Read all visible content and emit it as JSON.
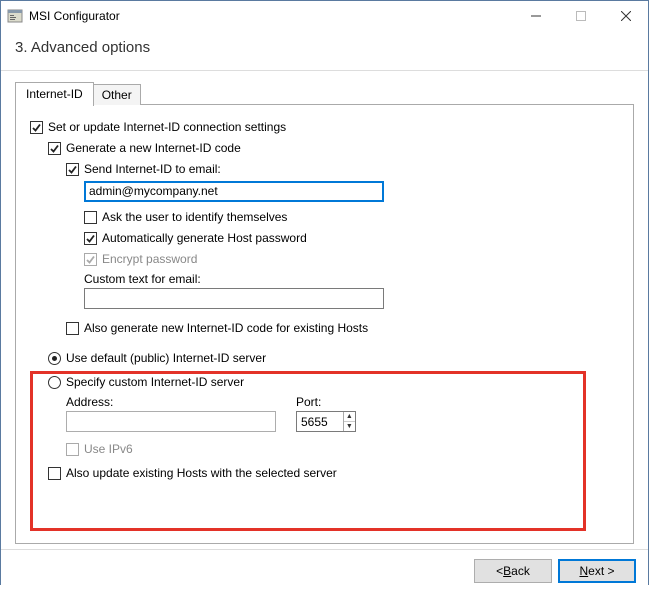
{
  "window": {
    "title": "MSI Configurator",
    "step_title": "3. Advanced options"
  },
  "tabs": {
    "active": "Internet-ID",
    "other": "Other"
  },
  "options": {
    "set_update": "Set or update Internet-ID connection settings",
    "generate_code": "Generate a new Internet-ID code",
    "send_email": "Send Internet-ID to email:",
    "email_value": "admin@mycompany.net",
    "ask_identify": "Ask the user to identify themselves",
    "auto_password": "Automatically generate Host password",
    "encrypt_password": "Encrypt password",
    "custom_text_label": "Custom text for email:",
    "custom_text_value": "",
    "also_generate_existing": "Also generate new Internet-ID code for existing Hosts",
    "use_default_server": "Use default (public) Internet-ID server",
    "specify_custom_server": "Specify custom Internet-ID server",
    "address_label": "Address:",
    "address_value": "",
    "port_label": "Port:",
    "port_value": "5655",
    "use_ipv6": "Use IPv6",
    "also_update_existing_server": "Also update existing Hosts with the selected server"
  },
  "buttons": {
    "back_prefix": "< ",
    "back_letter": "B",
    "back_rest": "ack",
    "next_letter": "N",
    "next_rest": "ext >"
  }
}
